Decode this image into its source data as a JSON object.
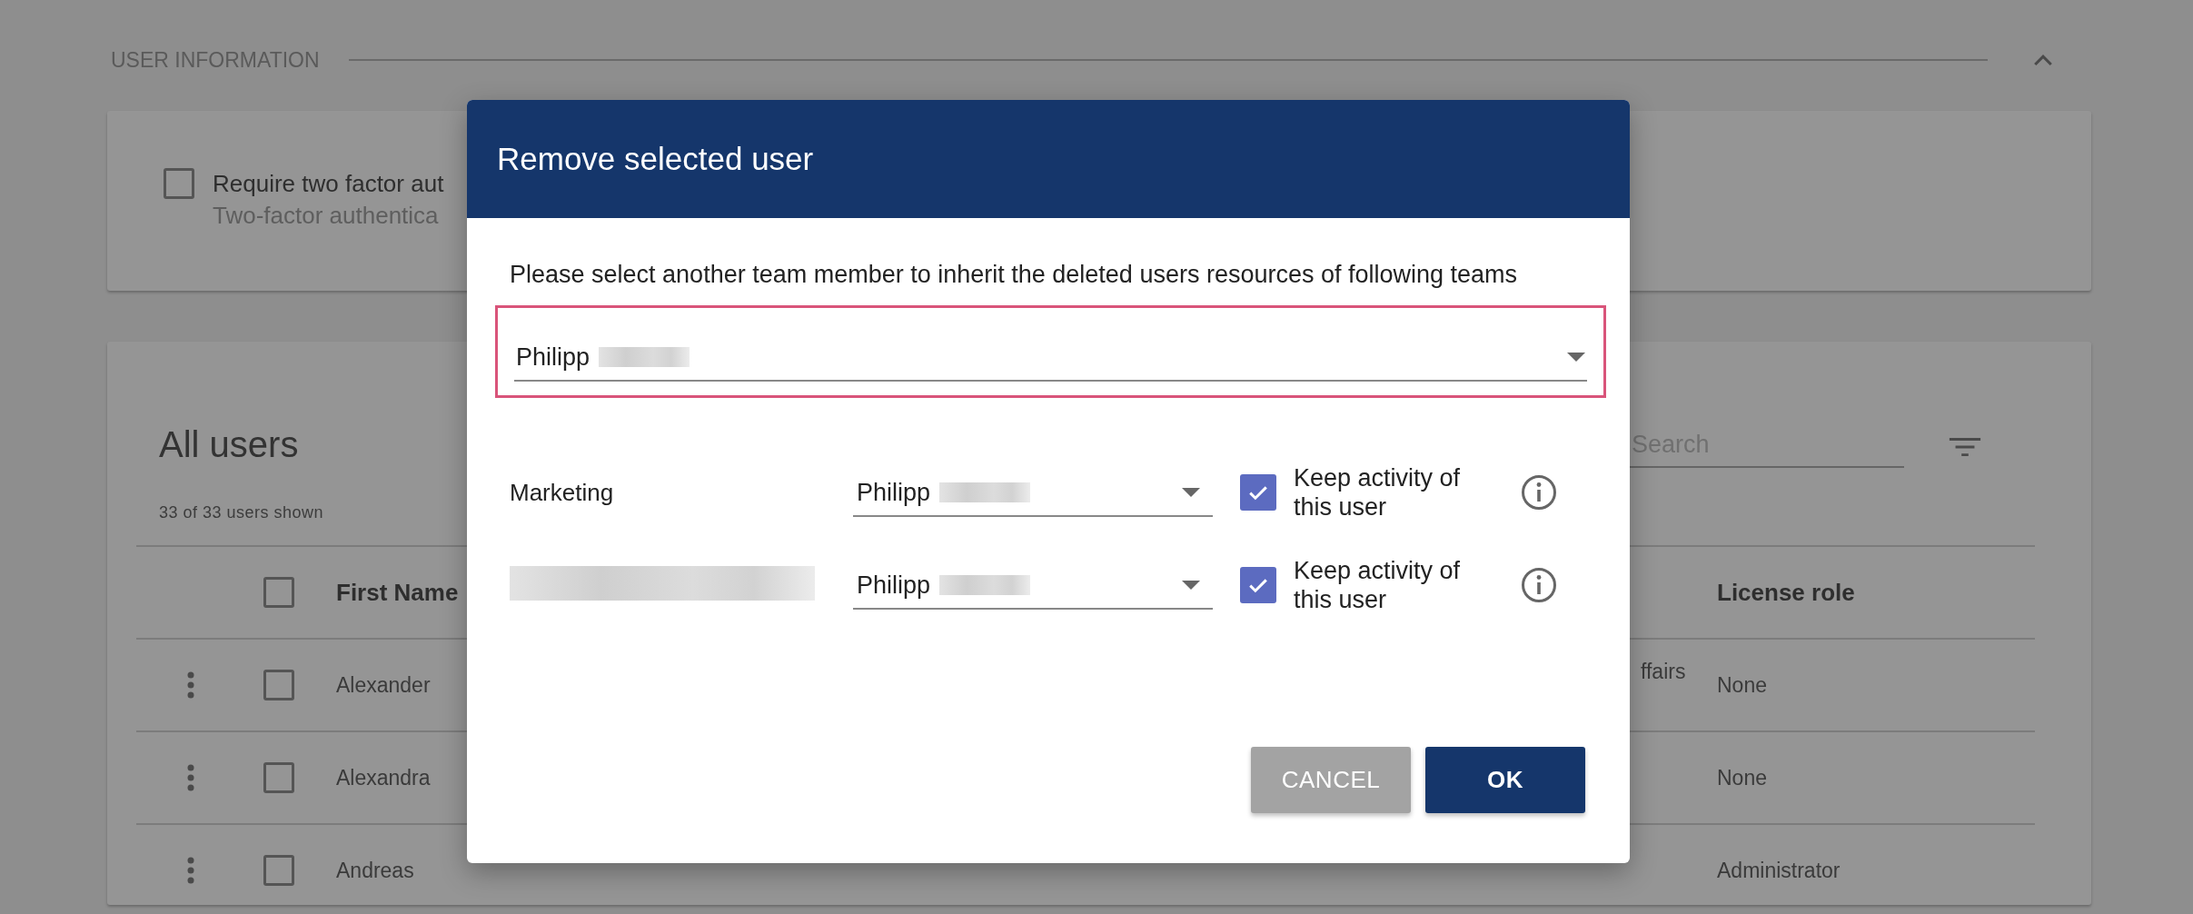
{
  "page": {
    "section_title": "USER INFORMATION",
    "section_expanded": true,
    "two_factor": {
      "label": "Require two factor aut",
      "description": "Two-factor authentica",
      "checked": false
    },
    "users": {
      "title": "All users",
      "count": "33 of 33 users shown",
      "search": {
        "placeholder": "Search"
      },
      "all_selected": false,
      "columns": [
        {
          "label": "First Name"
        },
        {
          "label": "License role"
        }
      ],
      "rows": [
        {
          "first_name": "Alexander",
          "column_3": "ffairs",
          "license_role": "None",
          "selected": false
        },
        {
          "first_name": "Alexandra",
          "license_role": "None",
          "selected": false
        },
        {
          "first_name": "Andreas",
          "license_role": "Administrator",
          "selected": false
        }
      ]
    }
  },
  "dialog": {
    "title": "Remove selected user",
    "message": "Please select another team member to inherit the deleted users resources of following teams",
    "inherit_select": {
      "value": "Philipp",
      "invalid": true
    },
    "teams": [
      {
        "name": "Marketing",
        "assignee": "Philipp",
        "keep_activity": {
          "label": "Keep activity of this user",
          "checked": true
        }
      },
      {
        "assignee": "Philipp",
        "keep_activity": {
          "label": "Keep activity of this user",
          "checked": true
        }
      }
    ],
    "buttons": [
      {
        "label": "CANCEL",
        "kind": "secondary"
      },
      {
        "label": "OK",
        "kind": "primary"
      }
    ]
  }
}
